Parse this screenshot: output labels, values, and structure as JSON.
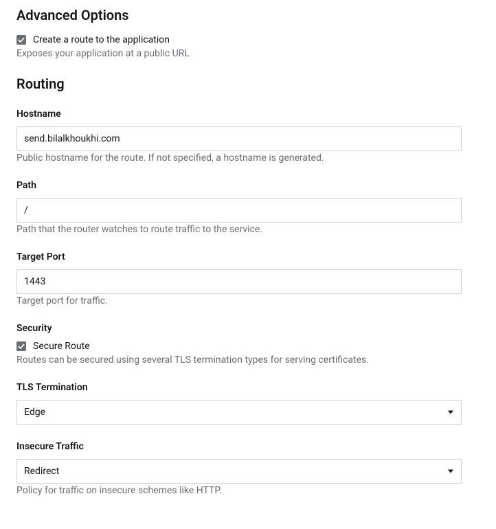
{
  "advancedOptions": {
    "title": "Advanced Options",
    "createRoute": {
      "label": "Create a route to the application",
      "help": "Exposes your application at a public URL"
    }
  },
  "routing": {
    "title": "Routing",
    "hostname": {
      "label": "Hostname",
      "value": "send.bilalkhoukhi.com",
      "help": "Public hostname for the route. If not specified, a hostname is generated."
    },
    "path": {
      "label": "Path",
      "value": "/",
      "help": "Path that the router watches to route traffic to the service."
    },
    "targetPort": {
      "label": "Target Port",
      "value": "1443",
      "help": "Target port for traffic."
    },
    "security": {
      "label": "Security",
      "secureRoute": "Secure Route",
      "help": "Routes can be secured using several TLS termination types for serving certificates."
    },
    "tlsTermination": {
      "label": "TLS Termination",
      "value": "Edge"
    },
    "insecureTraffic": {
      "label": "Insecure Traffic",
      "value": "Redirect",
      "help": "Policy for traffic on insecure schemes like HTTP."
    }
  }
}
